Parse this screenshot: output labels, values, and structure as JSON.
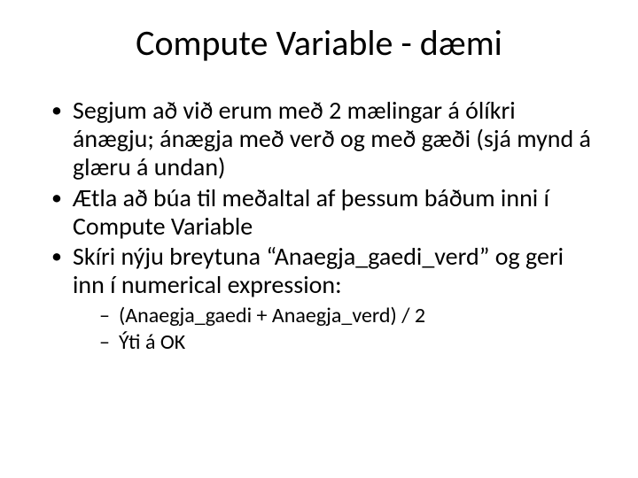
{
  "title": "Compute Variable - dæmi",
  "bullets": {
    "b1": "Segjum að við erum með 2 mælingar á ólíkri ánægju; ánægja með verð og með gæði (sjá mynd á glæru á undan)",
    "b2": "Ætla að búa til meðaltal af þessum báðum inni í Compute Variable",
    "b3": "Skíri nýju breytuna “Anaegja_gaedi_verd” og geri inn í numerical expression:",
    "sub1": "(Anaegja_gaedi + Anaegja_verd) / 2",
    "sub2": "Ýti á OK"
  }
}
